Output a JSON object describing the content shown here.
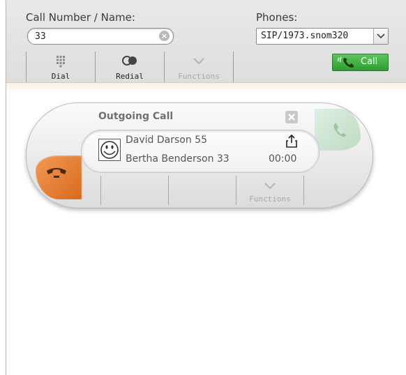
{
  "header": {
    "number_label": "Call Number / Name:",
    "number_value": "33",
    "phones_label": "Phones:",
    "phone_selected": "SIP/1973.snom320"
  },
  "toolbar": {
    "dial_label": "Dial",
    "redial_label": "Redial",
    "functions_label": "Functions",
    "call_label": "Call"
  },
  "call": {
    "title": "Outgoing Call",
    "caller": "David Darson 55",
    "callee": "Bertha Benderson 33",
    "duration": "00:00",
    "functions_label": "Functions"
  },
  "icons": {
    "dial": "dialpad-icon",
    "redial": "redial-icon",
    "functions": "chevron-down-icon",
    "call": "phone-icon",
    "hangup": "hangup-icon",
    "answer": "answer-icon",
    "avatar": "smiley-icon",
    "share": "share-icon",
    "close": "close-icon",
    "clear": "clear-icon"
  },
  "colors": {
    "call_green": "#3aa83d",
    "hangup_orange": "#e27a2c",
    "answer_green": "#c6e3cb"
  }
}
